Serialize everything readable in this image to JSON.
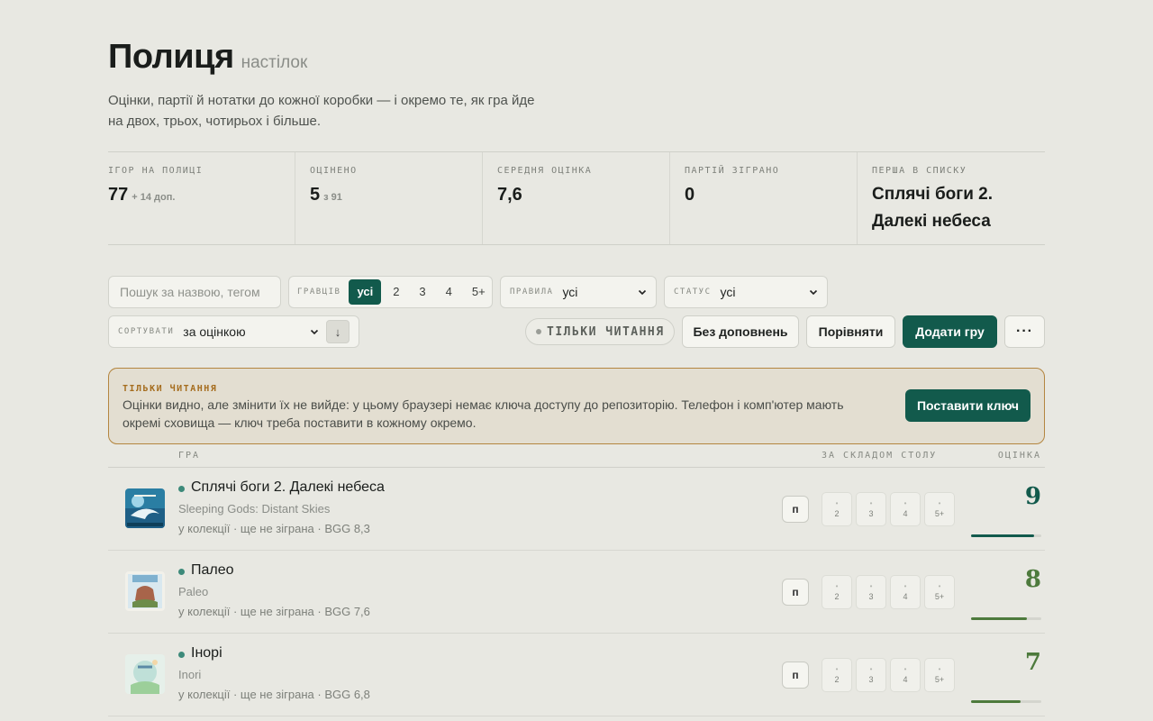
{
  "header": {
    "title": "Полиця",
    "subtitle": "настілок",
    "intro": "Оцінки, партії й нотатки до кожної коробки — і окремо те, як гра йде на двох, трьох, чотирьох і більше."
  },
  "stats": [
    {
      "label": "ІГОР НА ПОЛИЦІ",
      "value": "77",
      "sub": "+ 14 доп."
    },
    {
      "label": "ОЦІНЕНО",
      "value": "5",
      "sub": "з 91"
    },
    {
      "label": "СЕРЕДНЯ ОЦІНКА",
      "value": "7,6",
      "sub": ""
    },
    {
      "label": "ПАРТІЙ ЗІГРАНО",
      "value": "0",
      "sub": ""
    },
    {
      "label": "ПЕРША В СПИСКУ",
      "value": "Сплячі боги 2. Далекі небеса",
      "sub": ""
    }
  ],
  "filters": {
    "search_placeholder": "Пошук за назвою, тегом",
    "players_label": "ГРАВЦІВ",
    "player_options": [
      "усі",
      "2",
      "3",
      "4",
      "5+"
    ],
    "rules_label": "ПРАВИЛА",
    "rules_value": "усі",
    "status_label": "СТАТУС",
    "status_value": "усі",
    "sort_label": "СОРТУВАТИ",
    "sort_value": "за оцінкою",
    "sort_dir": "↓"
  },
  "toolbar": {
    "readonly_chip": "ТІЛЬКИ ЧИТАННЯ",
    "no_expansions": "Без доповнень",
    "compare": "Порівняти",
    "add_game": "Додати гру",
    "more": "···"
  },
  "banner": {
    "title": "ТІЛЬКИ ЧИТАННЯ",
    "text": "Оцінки видно, але змінити їх не вийде: у цьому браузері немає ключа доступу до репозиторію. Телефон і комп'ютер мають окремі сховища — ключ треба поставити в кожному окремо.",
    "button": "Поставити ключ"
  },
  "table": {
    "col_game": "ГРА",
    "col_table": "ЗА СКЛАДОМ СТОЛУ",
    "col_score": "ОЦІНКА",
    "player_counts": [
      "2",
      "3",
      "4",
      "5+"
    ],
    "p_label": "п",
    "rows": [
      {
        "name": "Сплячі боги 2. Далекі небеса",
        "original": "Sleeping Gods: Distant Skies",
        "meta": "у колекції · ще не зіграна · BGG 8,3",
        "score": "9",
        "score_value": 9,
        "color": "#125a4c",
        "cover": "sleeping-gods-cover"
      },
      {
        "name": "Палео",
        "original": "Paleo",
        "meta": "у колекції · ще не зіграна · BGG 7,6",
        "score": "8",
        "score_value": 8,
        "color": "#4d7a3c",
        "cover": "paleo-cover"
      },
      {
        "name": "Інорі",
        "original": "Inori",
        "meta": "у колекції · ще не зіграна · BGG 6,8",
        "score": "7",
        "score_value": 7,
        "color": "#4d7a3c",
        "cover": "inori-cover"
      }
    ]
  }
}
